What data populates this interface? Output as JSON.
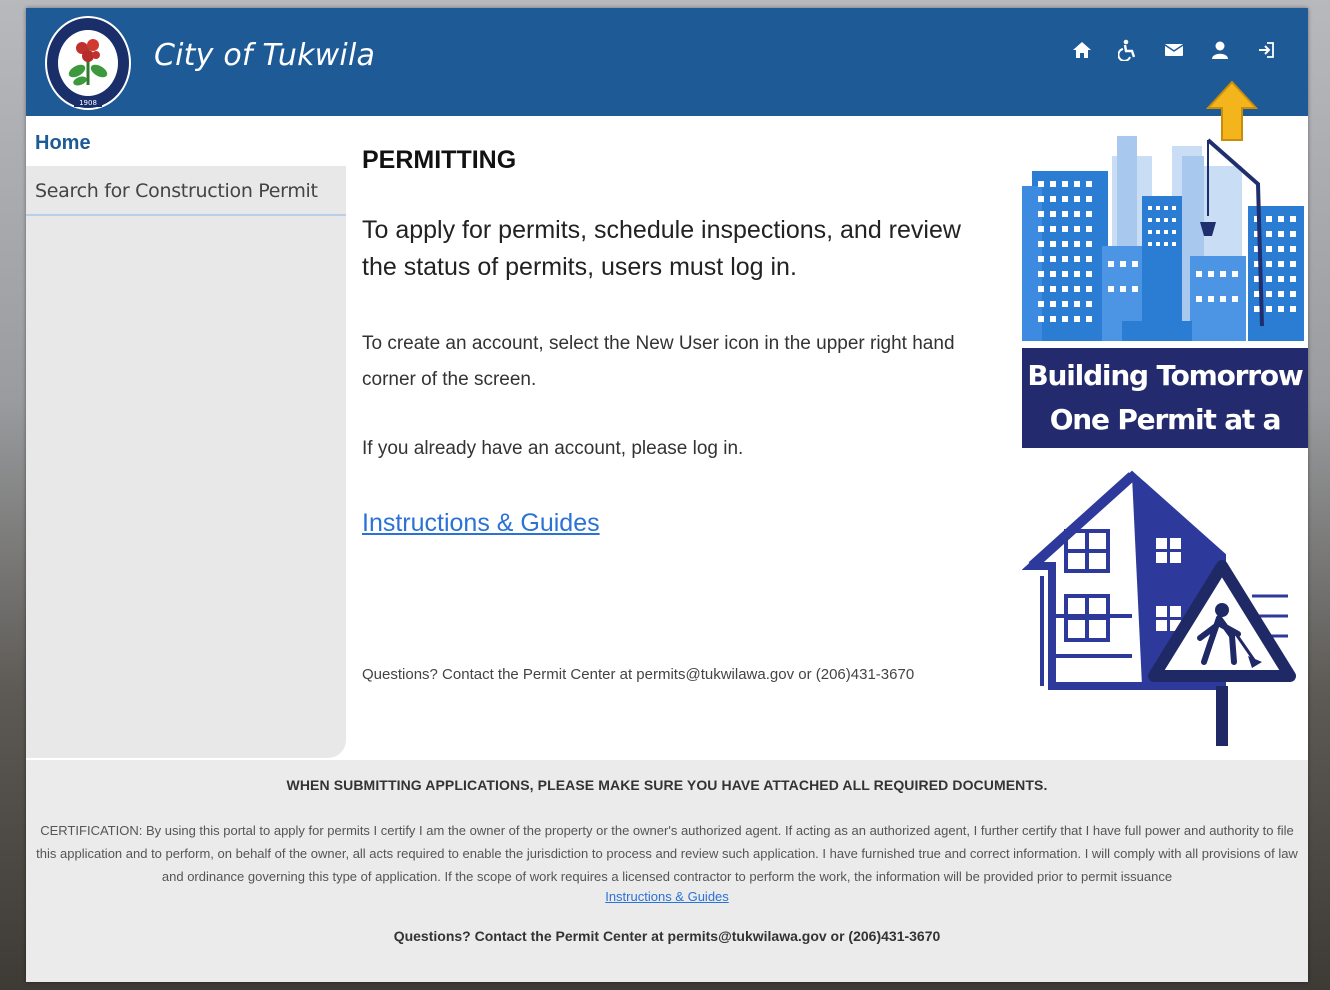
{
  "header": {
    "site_title": "City of Tukwila",
    "seal_text": "SEAL OF TUKWILA WASHINGTON",
    "seal_year": "1908",
    "icons": [
      "home-icon",
      "accessibility-icon",
      "mail-icon",
      "new-user-icon",
      "login-icon"
    ],
    "color": "#1d5a96"
  },
  "sidebar": {
    "home_label": "Home",
    "search_label": "Search for Construction Permit"
  },
  "main": {
    "title": "PERMITTING",
    "intro": "To apply for permits, schedule inspections, and review the status of permits, users must log in.",
    "create_account": "To create an account, select the New User icon in the upper right hand corner of the screen.",
    "have_account": "If you already have an account, please log in.",
    "guides_link": "Instructions & Guides",
    "questions": "Questions? Contact the Permit Center at permits@tukwilawa.gov or (206)431-3670"
  },
  "promo": {
    "line1": "Building Tomorrow",
    "line2": "One Permit at a Time"
  },
  "footer": {
    "warning": "WHEN SUBMITTING APPLICATIONS, PLEASE MAKE SURE YOU HAVE ATTACHED ALL REQUIRED DOCUMENTS.",
    "certification": "CERTIFICATION: By using this portal to apply for permits I certify I am the owner of the property or the owner's authorized agent. If acting as an authorized agent, I further certify that I have full power and authority to file this application and to perform, on behalf of the owner, all acts required to enable the jurisdiction to process and review such application. I have furnished true and correct information. I will comply with all provisions of law and ordinance governing this type of application. If the scope of work requires a licensed contractor to perform the work, the information will be provided prior to permit issuance",
    "guides_link": "Instructions & Guides",
    "questions": "Questions? Contact the Permit Center at permits@tukwilawa.gov or (206)431-3670"
  }
}
